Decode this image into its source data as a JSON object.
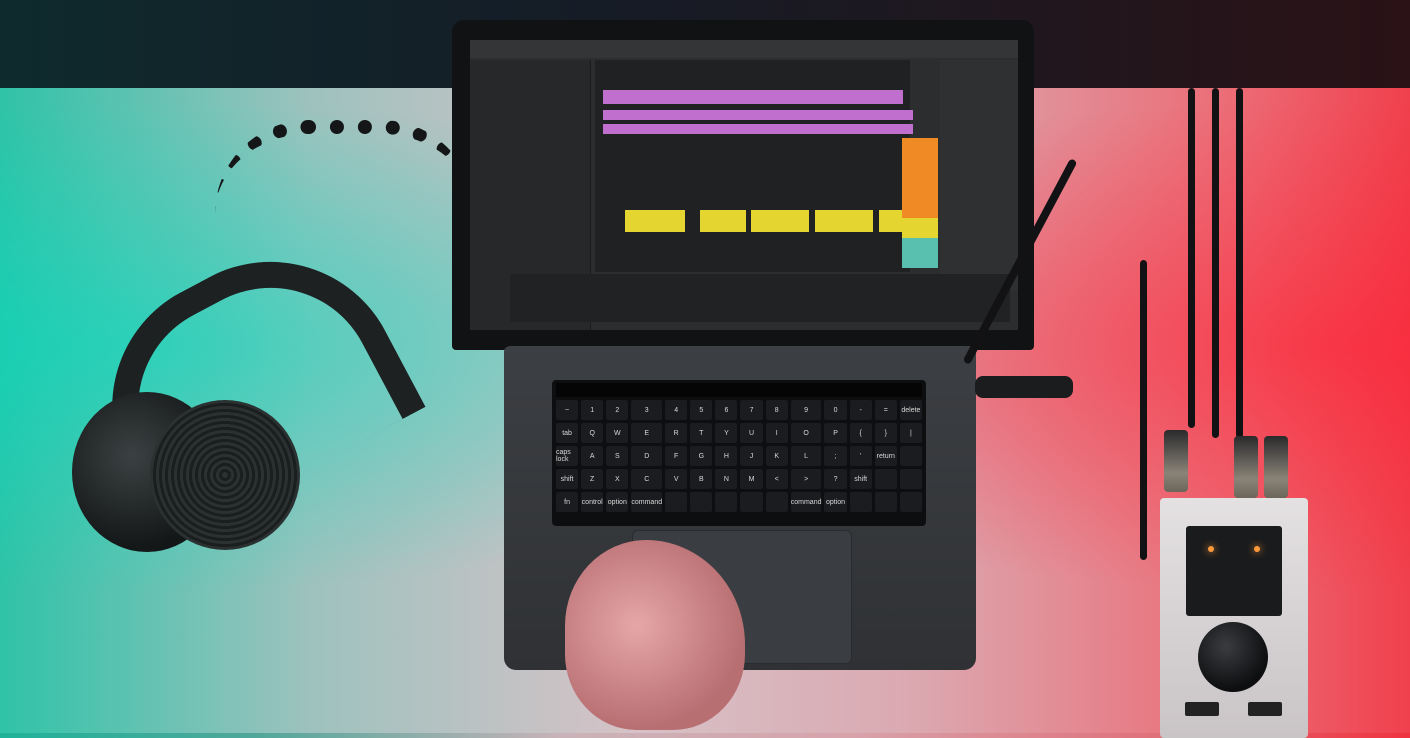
{
  "scene": {
    "objects": [
      "headphones",
      "laptop",
      "audio-interface",
      "hand",
      "cables"
    ]
  },
  "keyboard": {
    "rows": [
      [
        "~",
        "1",
        "2",
        "3",
        "4",
        "5",
        "6",
        "7",
        "8",
        "9",
        "0",
        "-",
        "=",
        "delete"
      ],
      [
        "tab",
        "Q",
        "W",
        "E",
        "R",
        "T",
        "Y",
        "U",
        "I",
        "O",
        "P",
        "{",
        "}",
        "|"
      ],
      [
        "caps lock",
        "A",
        "S",
        "D",
        "F",
        "G",
        "H",
        "J",
        "K",
        "L",
        ";",
        "'",
        "return",
        ""
      ],
      [
        "shift",
        "Z",
        "X",
        "C",
        "V",
        "B",
        "N",
        "M",
        "<",
        ">",
        "?",
        "shift",
        "",
        ""
      ],
      [
        "fn",
        "control",
        "option",
        "command",
        "",
        "",
        "",
        "",
        "",
        "command",
        "option",
        "",
        "",
        ""
      ]
    ]
  },
  "colors": {
    "left_light": "#1fb39a",
    "right_light": "#ef3340",
    "clip_purple": "#c06fcf",
    "clip_yellow": "#e5d530",
    "clip_orange": "#f08a24"
  }
}
